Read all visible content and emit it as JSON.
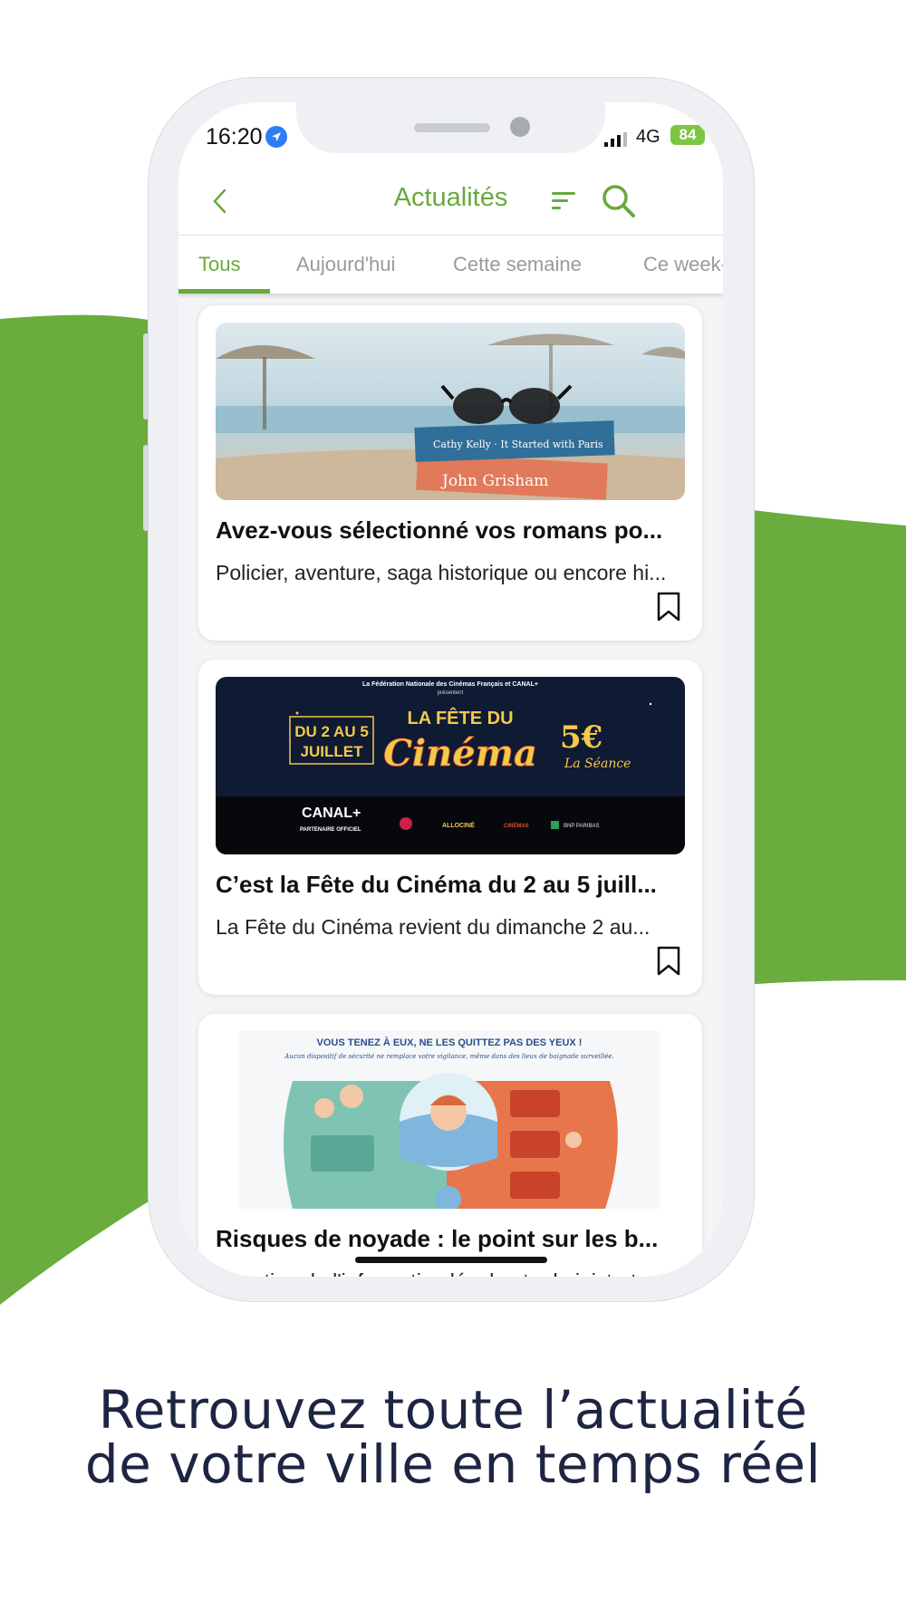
{
  "colors": {
    "brand_green": "#69a93c",
    "wave_green": "#6aac3d",
    "tagline_navy": "#1e2542"
  },
  "status_bar": {
    "time": "16:20",
    "network": "4G",
    "battery": "84"
  },
  "header": {
    "title": "Actualités",
    "back_icon": "chevron-left-icon",
    "filter_icon": "sort-lines-icon",
    "search_icon": "search-icon"
  },
  "tabs": [
    {
      "label": "Tous",
      "active": true
    },
    {
      "label": "Aujourd'hui",
      "active": false
    },
    {
      "label": "Cette semaine",
      "active": false
    },
    {
      "label": "Ce week-end",
      "active": false
    }
  ],
  "articles": [
    {
      "title": "Avez-vous sélectionné vos romans po...",
      "description": "Policier, aventure, saga historique ou encore hi...",
      "image_text": {
        "book1": "Cathy Kelly · It Started with Paris",
        "book2": "John Grisham"
      }
    },
    {
      "title": "C’est la Fête du Cinéma du 2 au 5 juill...",
      "description": "La Fête du Cinéma revient du dimanche 2 au...",
      "image_text": {
        "top": "La Fédération Nationale des Cinémas Français et CANAL+",
        "presente": "présentent",
        "dates_l1": "DU 2 AU 5",
        "dates_l2": "JUILLET",
        "fete": "LA FÊTE DU",
        "cinema": "Cinéma",
        "price": "5€",
        "seance": "La Séance",
        "canal": "CANAL+",
        "partner": "PARTENAIRE OFFICIEL",
        "sponsors": [
          "ALLOCINÉ",
          "CINÉMAS",
          "BNP PARIBAS"
        ]
      }
    },
    {
      "title": "Risques de noyade : le point sur les b...",
      "description": "Direction de l'information légale et administrat...",
      "image_text": {
        "headline": "VOUS TENEZ À EUX, NE LES QUITTEZ PAS DES YEUX !",
        "subline": "Aucun dispositif de sécurité ne remplace votre vigilance, même dans des lieux de baignade surveillée."
      }
    }
  ],
  "tagline": {
    "line1": "Retrouvez toute l’actualité",
    "line2": "de votre ville en temps réel"
  }
}
